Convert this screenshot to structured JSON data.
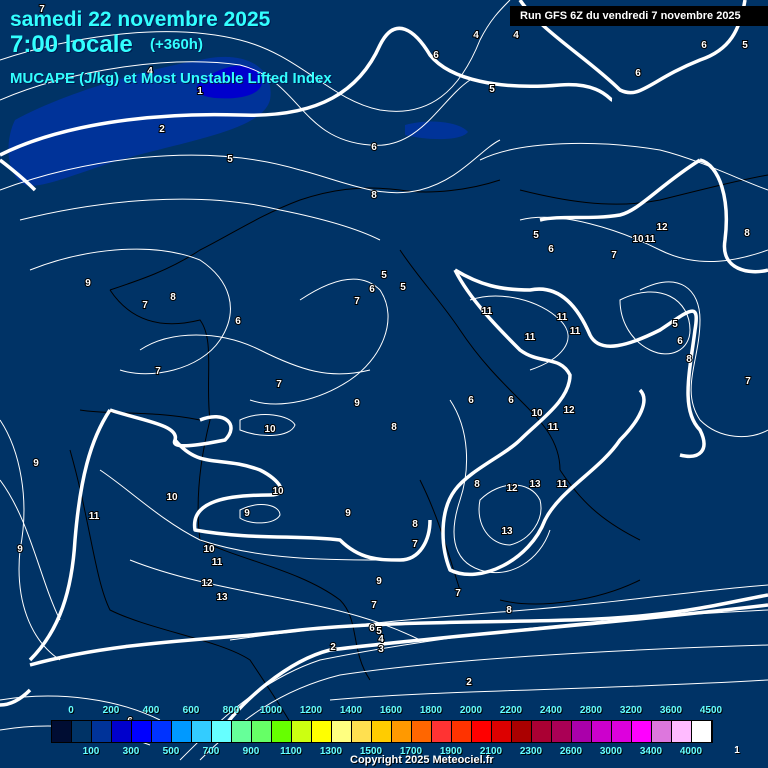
{
  "header": {
    "date": "samedi 22 novembre 2025",
    "time": "7:00 locale",
    "lead": "(+360h)",
    "parameter": "MUCAPE (J/kg) et Most Unstable Lifted Index",
    "run": "Run GFS 6Z du vendredi 7 novembre 2025"
  },
  "colors": {
    "background": "#003366",
    "scale": [
      "#000d33",
      "#003366",
      "#003399",
      "#0000cc",
      "#0000ff",
      "#0033ff",
      "#0099ff",
      "#33ccff",
      "#66ffff",
      "#66ff99",
      "#66ff66",
      "#66ff00",
      "#ccff11",
      "#ffff00",
      "#ffff80",
      "#ffe050",
      "#ffcc00",
      "#ff9900",
      "#ff6600",
      "#ff3333",
      "#ff3300",
      "#ff0000",
      "#dd0000",
      "#aa0000",
      "#aa0033",
      "#aa0055",
      "#aa00aa",
      "#cc00cc",
      "#dd00dd",
      "#ff00ff",
      "#dd77dd",
      "#ffbbff",
      "#ffffff"
    ]
  },
  "legend": {
    "top_labels": [
      "0",
      "200",
      "400",
      "600",
      "800",
      "1000",
      "1200",
      "1400",
      "1600",
      "1800",
      "2000",
      "2200",
      "2400",
      "2800",
      "3200",
      "3600",
      "4500"
    ],
    "bottom_labels": [
      "100",
      "300",
      "500",
      "700",
      "900",
      "1100",
      "1300",
      "1500",
      "1700",
      "1900",
      "2100",
      "2300",
      "2600",
      "3000",
      "3400",
      "4000"
    ],
    "extra_label": "1"
  },
  "lifted_index_labels": [
    "7",
    "4",
    "1",
    "2",
    "5",
    "6",
    "4",
    "4",
    "6",
    "5",
    "6",
    "5",
    "6",
    "8",
    "12",
    "8",
    "5",
    "6",
    "10",
    "11",
    "7",
    "9",
    "7",
    "8",
    "5",
    "5",
    "6",
    "7",
    "6",
    "11",
    "11",
    "11",
    "11",
    "5",
    "6",
    "8",
    "7",
    "7",
    "7",
    "9",
    "6",
    "6",
    "10",
    "12",
    "11",
    "10",
    "8",
    "9",
    "8",
    "12",
    "13",
    "11",
    "10",
    "10",
    "11",
    "9",
    "9",
    "8",
    "7",
    "13",
    "9",
    "10",
    "11",
    "12",
    "9",
    "13",
    "7",
    "7",
    "8",
    "6",
    "5",
    "4",
    "3",
    "2",
    "2",
    "6"
  ],
  "copyright": "Copyright 2025 Meteociel.fr"
}
